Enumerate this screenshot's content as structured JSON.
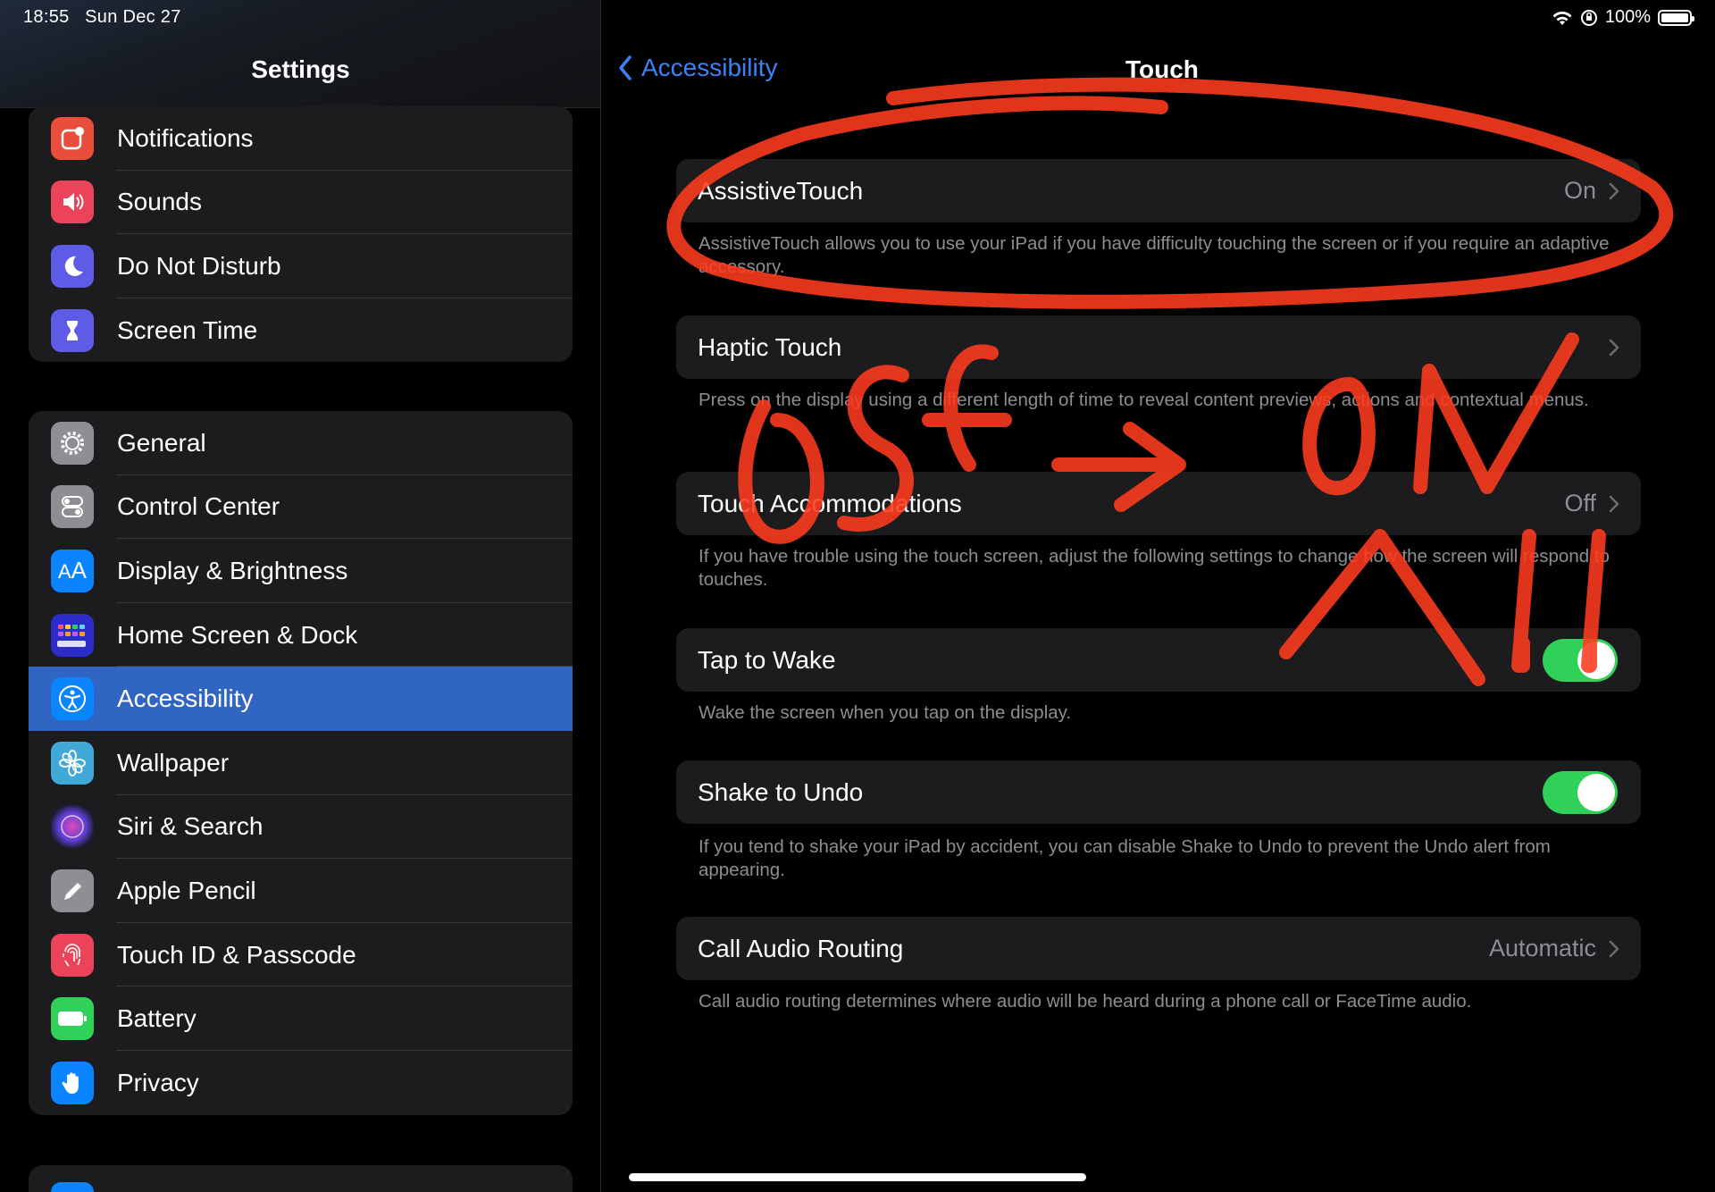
{
  "status_bar": {
    "time": "18:55",
    "date": "Sun Dec 27",
    "battery_text": "100%"
  },
  "sidebar": {
    "title": "Settings",
    "group1": [
      {
        "label": "Notifications",
        "icon": "notifications-icon",
        "color": "#eb4d3d"
      },
      {
        "label": "Sounds",
        "icon": "sounds-icon",
        "color": "#eb445a"
      },
      {
        "label": "Do Not Disturb",
        "icon": "moon-icon",
        "color": "#5e5ce6"
      },
      {
        "label": "Screen Time",
        "icon": "hourglass-icon",
        "color": "#5e5ce6"
      }
    ],
    "group2": [
      {
        "label": "General",
        "icon": "gear-icon",
        "color": "#8e8e93"
      },
      {
        "label": "Control Center",
        "icon": "switches-icon",
        "color": "#8e8e93"
      },
      {
        "label": "Display & Brightness",
        "icon": "text-size-icon",
        "color": "#0a84ff"
      },
      {
        "label": "Home Screen & Dock",
        "icon": "app-grid-icon",
        "color": "#3a3ae0"
      },
      {
        "label": "Accessibility",
        "icon": "accessibility-icon",
        "color": "#0a84ff",
        "selected": true
      },
      {
        "label": "Wallpaper",
        "icon": "flower-icon",
        "color": "#40a9d8"
      },
      {
        "label": "Siri & Search",
        "icon": "siri-icon",
        "color": "#2c2c3e"
      },
      {
        "label": "Apple Pencil",
        "icon": "pencil-icon",
        "color": "#8e8e93"
      },
      {
        "label": "Touch ID & Passcode",
        "icon": "fingerprint-icon",
        "color": "#eb445a"
      },
      {
        "label": "Battery",
        "icon": "battery-icon",
        "color": "#30d158"
      },
      {
        "label": "Privacy",
        "icon": "hand-icon",
        "color": "#0a84ff"
      }
    ]
  },
  "detail": {
    "back_label": "Accessibility",
    "title": "Touch",
    "items": [
      {
        "label": "AssistiveTouch",
        "value": "On",
        "footer": "AssistiveTouch allows you to use your iPad if you have difficulty touching the screen or if you require an adaptive accessory."
      },
      {
        "label": "Haptic Touch",
        "value": "",
        "footer": "Press on the display using a different length of time to reveal content previews, actions and contextual menus."
      },
      {
        "label": "Touch Accommodations",
        "value": "Off",
        "footer": "If you have trouble using the touch screen, adjust the following settings to change how the screen will respond to touches."
      },
      {
        "label": "Tap to Wake",
        "toggle_on": true,
        "footer": "Wake the screen when you tap on the display."
      },
      {
        "label": "Shake to Undo",
        "toggle_on": true,
        "footer": "If you tend to shake your iPad by accident, you can disable Shake to Undo to prevent the Undo alert from appearing."
      },
      {
        "label": "Call Audio Routing",
        "value": "Automatic",
        "footer": "Call audio routing determines where audio will be heard during a phone call or FaceTime audio."
      }
    ]
  },
  "colors": {
    "accent": "#3b82f6",
    "selected_row": "#3065c2",
    "toggle_on": "#30d158",
    "annotation": "#ff3b1f"
  }
}
